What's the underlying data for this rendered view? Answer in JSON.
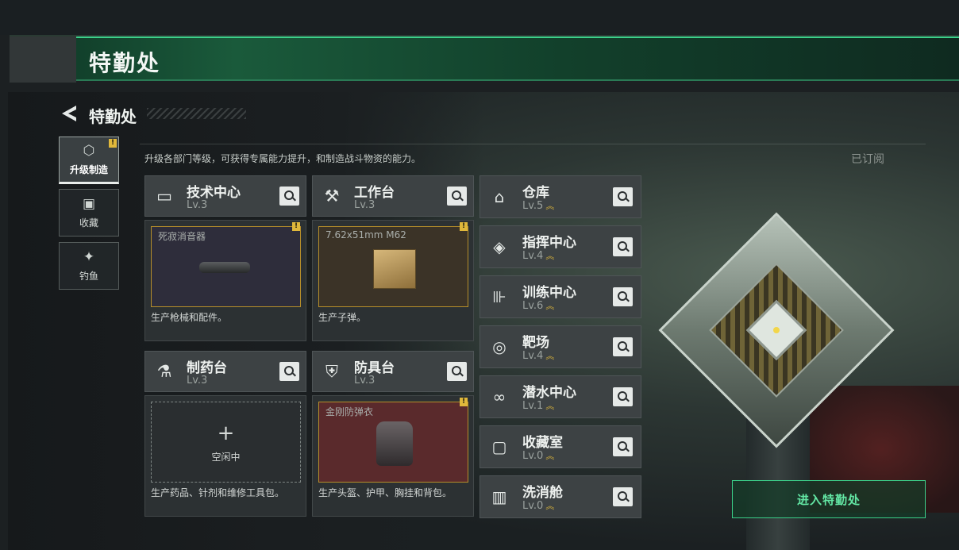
{
  "banner": {
    "title": "特勤处"
  },
  "header": {
    "title": "特勤处",
    "subtitle": "升级各部门等级，可获得专属能力提升，和制造战斗物资的能力。",
    "subscribed": "已订阅"
  },
  "nav": [
    {
      "label": "升级制造",
      "icon": "upgrade-icon",
      "active": true,
      "alert": "!"
    },
    {
      "label": "收藏",
      "icon": "collection-icon",
      "active": false
    },
    {
      "label": "钓鱼",
      "icon": "fish-icon",
      "active": false
    }
  ],
  "cards": [
    {
      "name": "技术中心",
      "level": "Lv.3",
      "icon": "monitor-icon",
      "slot_label": "死寂消音器",
      "desc": "生产枪械和配件。",
      "alert": "!"
    },
    {
      "name": "工作台",
      "level": "Lv.3",
      "icon": "tools-icon",
      "slot_label": "7.62x51mm M62",
      "desc": "生产子弹。",
      "alert": "!"
    },
    {
      "name": "制药台",
      "level": "Lv.3",
      "icon": "microscope-icon",
      "slot_label": "空闲中",
      "desc": "生产药品、针剂和维修工具包。",
      "empty_symbol": "+"
    },
    {
      "name": "防具台",
      "level": "Lv.3",
      "icon": "armor-icon",
      "slot_label": "金刚防弹衣",
      "desc": "生产头盔、护甲、胸挂和背包。",
      "alert": "!"
    }
  ],
  "rooms": [
    {
      "name": "仓库",
      "level": "Lv.5",
      "icon": "warehouse-icon"
    },
    {
      "name": "指挥中心",
      "level": "Lv.4",
      "icon": "chip-icon"
    },
    {
      "name": "训练中心",
      "level": "Lv.6",
      "icon": "dumbbell-icon"
    },
    {
      "name": "靶场",
      "level": "Lv.4",
      "icon": "target-icon"
    },
    {
      "name": "潜水中心",
      "level": "Lv.1",
      "icon": "diving-mask-icon"
    },
    {
      "name": "收藏室",
      "level": "Lv.0",
      "icon": "display-case-icon"
    },
    {
      "name": "洗消舱",
      "level": "Lv.0",
      "icon": "decon-chamber-icon"
    }
  ],
  "enter_button": "进入特勤处"
}
